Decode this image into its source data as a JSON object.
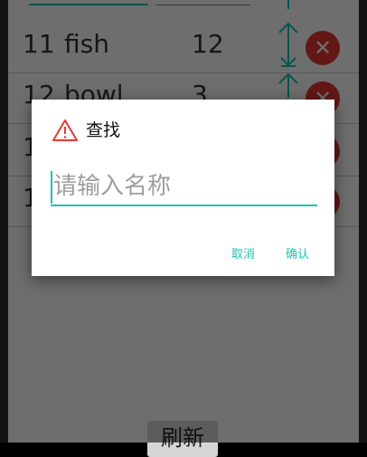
{
  "colors": {
    "accent": "#1bc3b6",
    "delete": "#e53935",
    "warning": "#e53935"
  },
  "list": {
    "rows": [
      {
        "id": "11",
        "name": "fish",
        "qty": "12"
      },
      {
        "id": "12",
        "name": "bowl",
        "qty": "3"
      },
      {
        "id": "1",
        "name": "",
        "qty": ""
      },
      {
        "id": "1",
        "name": "",
        "qty": ""
      }
    ],
    "delete_icon": "close-icon"
  },
  "refresh_label": "刷新",
  "dialog": {
    "icon": "warning-icon",
    "title": "查找",
    "input_placeholder": "请输入名称",
    "input_value": "",
    "cancel_label": "取消",
    "confirm_label": "确认"
  }
}
